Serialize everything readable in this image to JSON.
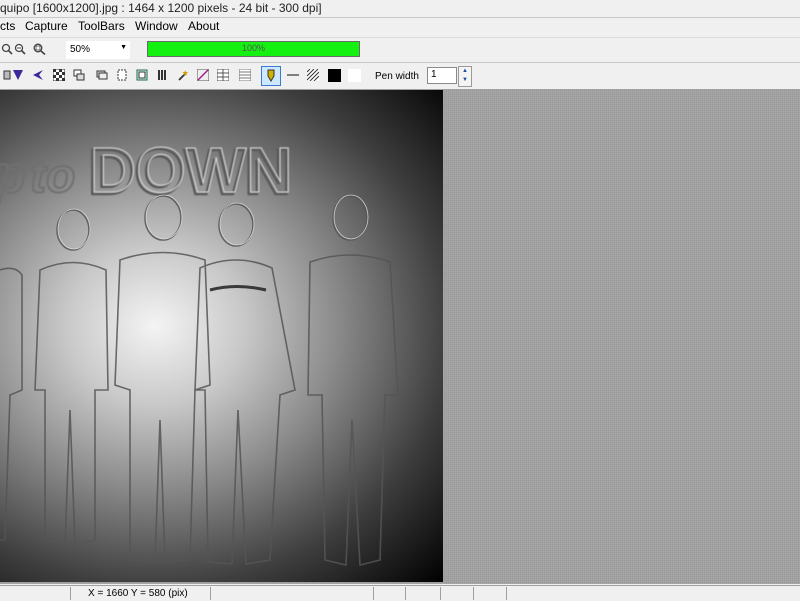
{
  "window": {
    "title": "quipo [1600x1200].jpg : 1464 x 1200 pixels - 24 bit - 300 dpi]"
  },
  "menu": {
    "items": [
      {
        "label": "cts"
      },
      {
        "label": "Capture"
      },
      {
        "label": "ToolBars"
      },
      {
        "label": "Window"
      },
      {
        "label": "About"
      }
    ]
  },
  "toolbar1": {
    "zoom_icons": [
      "zoom-in-icon",
      "zoom-out-icon",
      "zoom-fit-icon"
    ],
    "zoom_value": "50%",
    "progress_label": "100%",
    "progress_fraction": 1.0,
    "progress_color": "#14f010"
  },
  "toolbar2": {
    "pen_width_label": "Pen width",
    "pen_width_value": "1",
    "active_tool_highlight": "#cde8ff"
  },
  "image": {
    "description_text": "ptoDOWN"
  },
  "status": {
    "coords": "X = 1660   Y = 580 (pix)"
  }
}
